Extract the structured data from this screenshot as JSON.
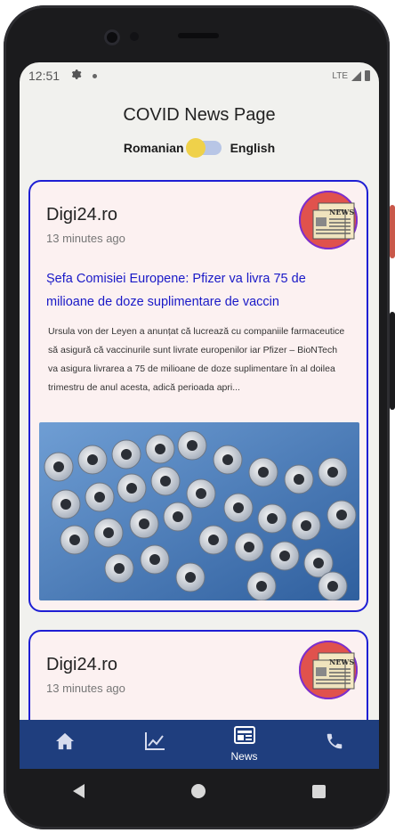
{
  "status_bar": {
    "time": "12:51",
    "network": "LTE"
  },
  "page": {
    "title": "COVID News Page"
  },
  "language_toggle": {
    "left_label": "Romanian",
    "right_label": "English",
    "knob_color": "#efd14a",
    "track_color": "#b8c6e6"
  },
  "articles": [
    {
      "source": "Digi24.ro",
      "time_ago": "13 minutes ago",
      "headline": "Șefa Comisiei Europene: Pfizer va livra 75 de milioane de doze suplimentare de vaccin",
      "summary": "Ursula von der Leyen a anunțat că lucrează cu companiile farmaceutice să asigură că vaccinurile sunt livrate europenilor iar Pfizer – BioNTech va asigura livrarea a 75 de milioane de doze suplimentare în al doilea trimestru de anul acesta, adică perioada apri...",
      "icon_text": "NEWS",
      "image": "vaccine-vials-photo"
    },
    {
      "source": "Digi24.ro",
      "time_ago": "13 minutes ago",
      "icon_text": "NEWS"
    }
  ],
  "bottom_nav": {
    "items": [
      {
        "icon": "home-icon",
        "label": ""
      },
      {
        "icon": "chart-icon",
        "label": ""
      },
      {
        "icon": "news-icon",
        "label": "News"
      },
      {
        "icon": "phone-icon",
        "label": ""
      }
    ],
    "active_index": 2
  },
  "colors": {
    "accent": "#1f1fd4",
    "card_bg": "#fcf1f1",
    "nav_bg": "#1f3e7e",
    "headline": "#1919c7"
  }
}
